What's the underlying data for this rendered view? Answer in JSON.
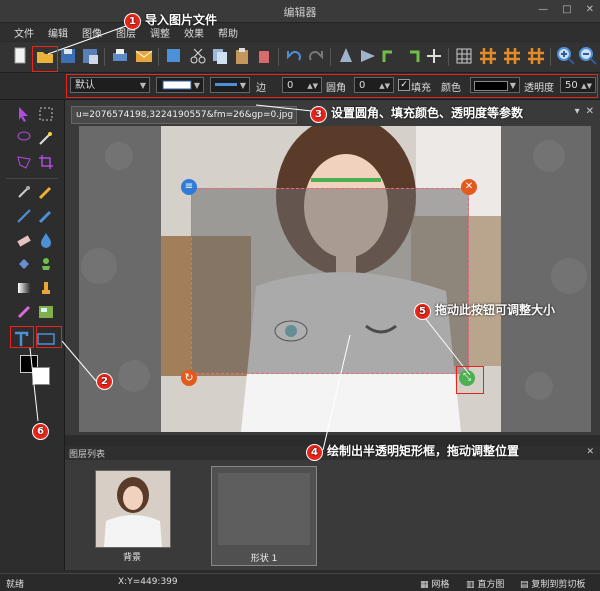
{
  "window": {
    "title": "编辑器"
  },
  "menu": [
    "文件",
    "编辑",
    "图像",
    "图层",
    "调整",
    "效果",
    "帮助"
  ],
  "propbar": {
    "preset": "默认",
    "edge_label": "边",
    "edge_value": "0",
    "radius_label": "圆角",
    "radius_value": "0",
    "fill_label": "填充",
    "fill_checked": true,
    "color_label": "颜色",
    "color_value": "#000000",
    "opacity_label": "透明度",
    "opacity_value": "50"
  },
  "document": {
    "tab_name": "u=2076574198,3224190557&fm=26&gp=0.jpg *"
  },
  "layers": {
    "header": "图层列表",
    "items": [
      {
        "name": "背景"
      },
      {
        "name": "形状 1"
      }
    ]
  },
  "status": {
    "left": "就绪",
    "coords": "X:Y=449:399",
    "grid": "网格",
    "histogram": "直方图",
    "copy": "复制到剪切板"
  },
  "annotations": {
    "a1": {
      "num": "1",
      "text": "导入图片文件"
    },
    "a2": {
      "num": "2"
    },
    "a3": {
      "num": "3",
      "text": "设置圆角、填充颜色、透明度等参数"
    },
    "a4": {
      "num": "4",
      "text": "绘制出半透明矩形框，拖动调整位置"
    },
    "a5": {
      "num": "5",
      "text": "拖动此按钮可调整大小"
    },
    "a6": {
      "num": "6"
    }
  },
  "colors": {
    "accent": "#e8251a",
    "handle_blue": "#2f7bd8",
    "handle_orange": "#e35a1c"
  }
}
